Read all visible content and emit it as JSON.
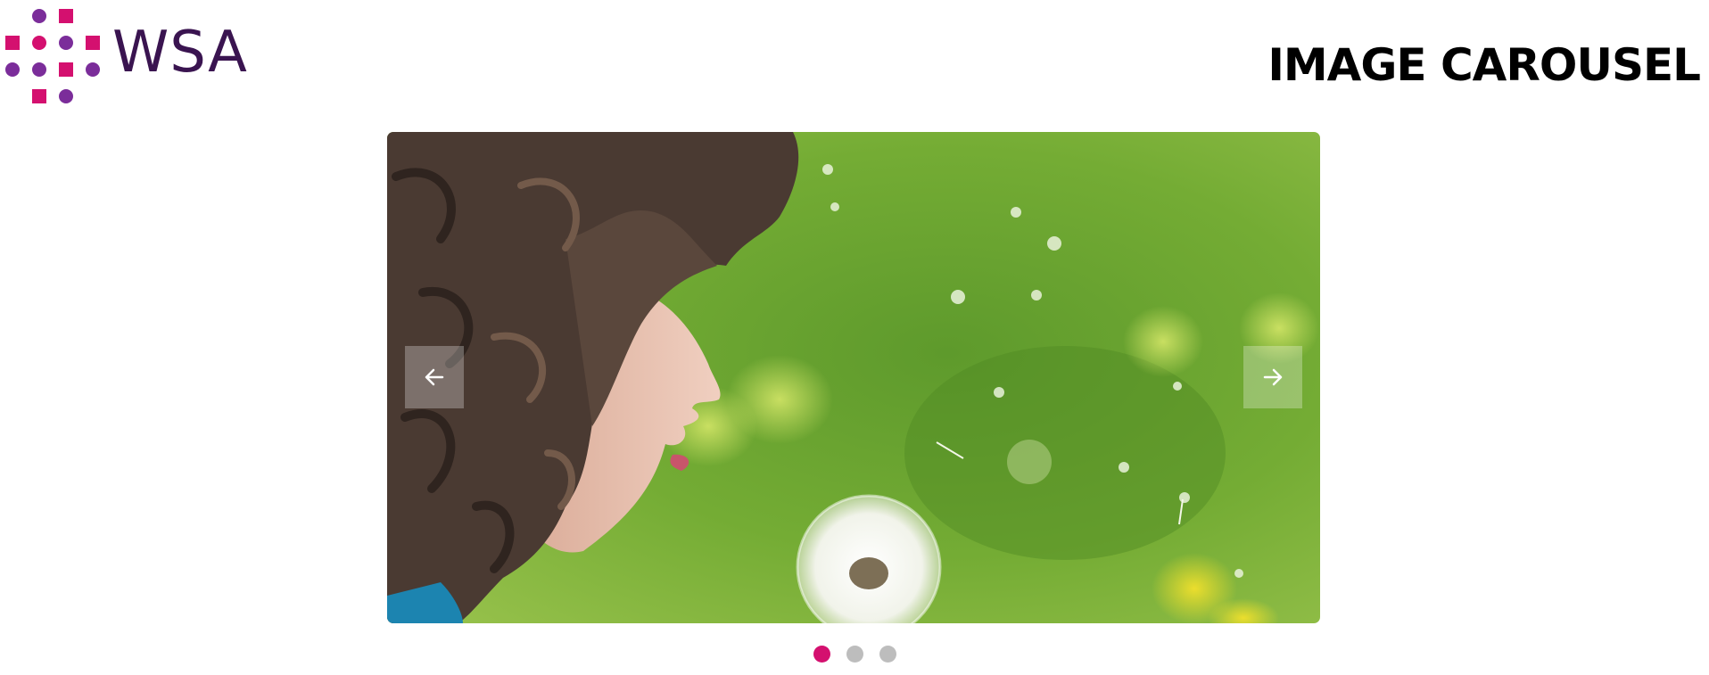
{
  "brand": {
    "name": "WSA",
    "icon": "dot-grid-logo-icon",
    "wordmark_color": "#3a1450",
    "colors": {
      "pink": "#d4106f",
      "purple": "#7b2d9a"
    }
  },
  "header": {
    "title": "IMAGE CAROUSEL"
  },
  "carousel": {
    "slide_count": 3,
    "active_index": 0,
    "image_icon": "child-blowing-dandelion-photo",
    "prev_icon": "arrow-left-icon",
    "next_icon": "arrow-right-icon",
    "colors": {
      "indicator_active": "#d4106f",
      "indicator_inactive": "#bdbdbd",
      "nav_arrow": "#ffffff"
    }
  }
}
